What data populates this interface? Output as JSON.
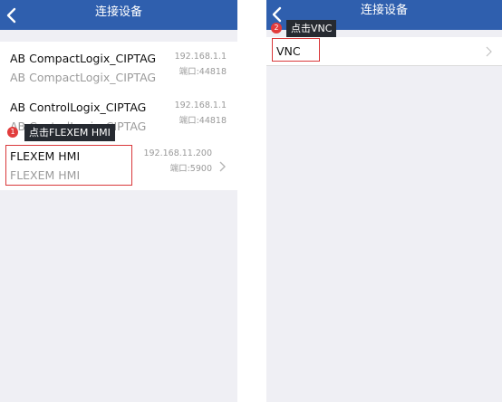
{
  "left": {
    "title": "连接设备",
    "devices": [
      {
        "name": "AB CompactLogix_CIPTAG",
        "subtitle": "AB CompactLogix_CIPTAG",
        "ip": "192.168.1.1",
        "port": "端口:44818"
      },
      {
        "name": "AB ControlLogix_CIPTAG",
        "subtitle": "AB ControlLogix_CIPTAG",
        "ip": "192.168.1.1",
        "port": "端口:44818"
      },
      {
        "name": "FLEXEM HMI",
        "subtitle": "FLEXEM HMI",
        "ip": "192.168.11.200",
        "port": "端口:5900"
      }
    ],
    "step": {
      "number": "1",
      "text": "点击FLEXEM HMI"
    }
  },
  "right": {
    "title": "连接设备",
    "items": [
      {
        "name": "VNC"
      }
    ],
    "step": {
      "number": "2",
      "text": "点击VNC"
    }
  },
  "colors": {
    "header": "#2f5fae",
    "background": "#efeff4",
    "highlight": "#d9383a",
    "tooltip": "#262a31",
    "badge": "#e23c3c"
  },
  "icons": {
    "back": "chevron-left-icon",
    "row_arrow": "chevron-right-icon"
  }
}
